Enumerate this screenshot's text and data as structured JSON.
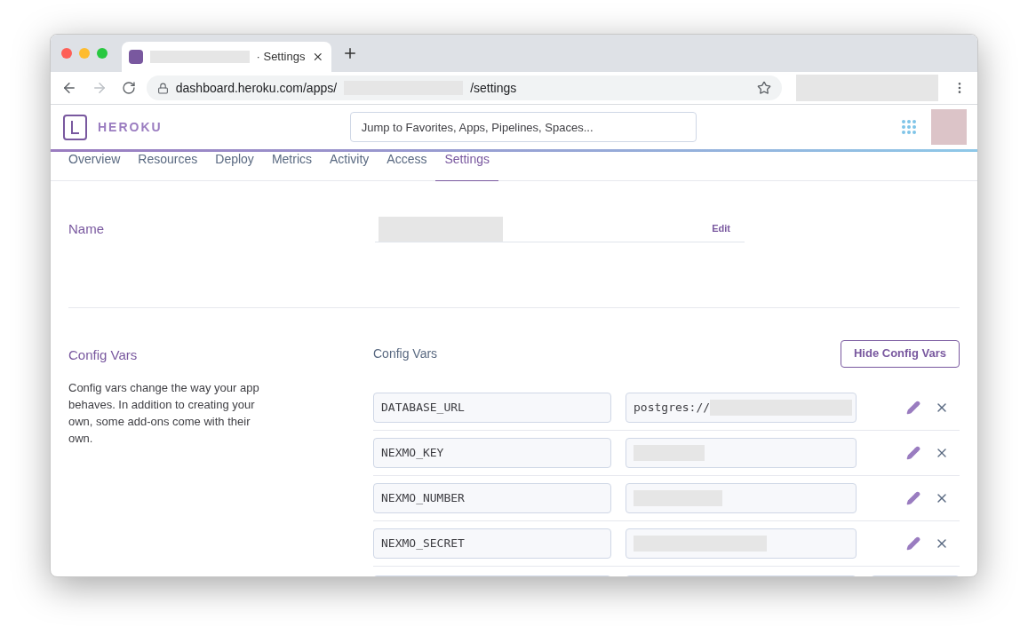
{
  "browser": {
    "tab": {
      "title": "· Settings",
      "selected": true
    },
    "url": {
      "host": "dashboard.heroku.com/apps/",
      "path": "/settings"
    }
  },
  "header": {
    "brand": "HEROKU",
    "search": {
      "placeholder": "Jump to Favorites, Apps, Pipelines, Spaces..."
    }
  },
  "nav": [
    {
      "label": "Overview",
      "selected": false
    },
    {
      "label": "Resources",
      "selected": false
    },
    {
      "label": "Deploy",
      "selected": false
    },
    {
      "label": "Metrics",
      "selected": false
    },
    {
      "label": "Activity",
      "selected": false
    },
    {
      "label": "Access",
      "selected": false
    },
    {
      "label": "Settings",
      "selected": true
    }
  ],
  "name_section": {
    "title": "Name",
    "edit": "Edit"
  },
  "config_section": {
    "title": "Config Vars",
    "description": "Config vars change the way your app behaves. In addition to creating your own, some add-ons come with their own.",
    "list_title": "Config Vars",
    "hide_button": "Hide Config Vars",
    "vars": [
      {
        "key": "DATABASE_URL",
        "value": "postgres://"
      },
      {
        "key": "NEXMO_KEY"
      },
      {
        "key": "NEXMO_NUMBER"
      },
      {
        "key": "NEXMO_SECRET"
      }
    ]
  }
}
